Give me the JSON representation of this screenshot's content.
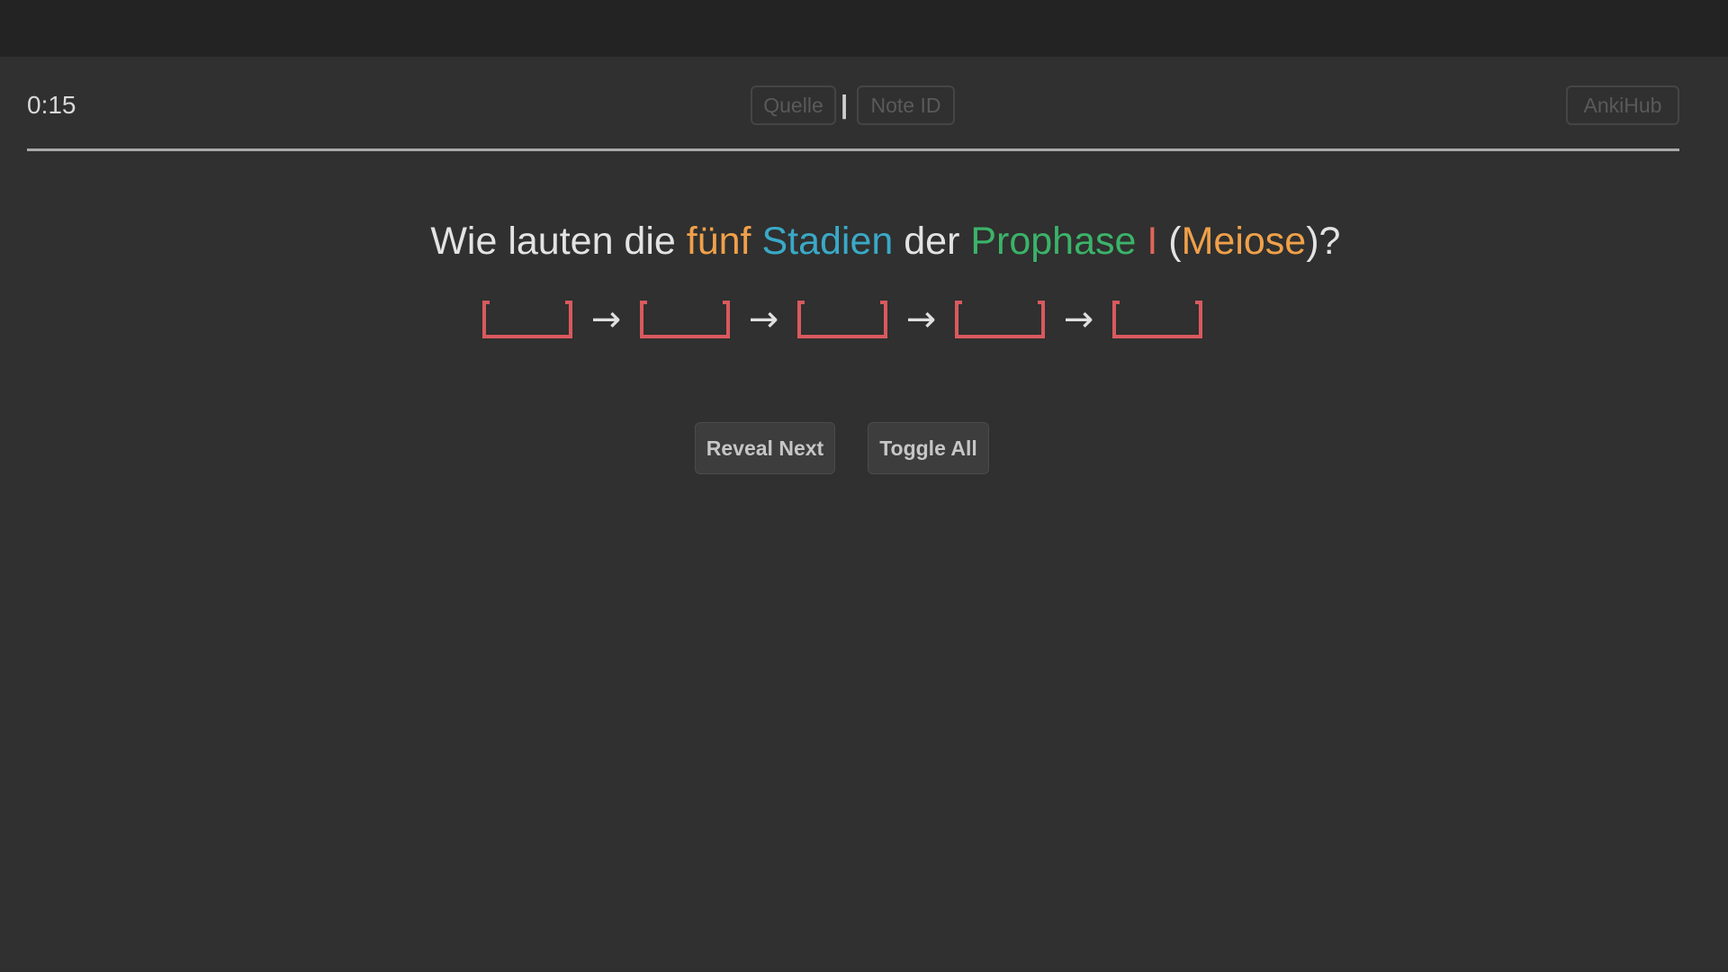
{
  "header": {
    "timer": "0:15",
    "source_label": "Quelle",
    "separator": "|",
    "note_id_label": "Note ID",
    "ankihub_label": "AnkiHub"
  },
  "question": {
    "segments": [
      {
        "text": "Wie lauten die ",
        "color": "#e3e3e3"
      },
      {
        "text": "fünf",
        "color": "#f0a04a"
      },
      {
        "text": " ",
        "color": "#e3e3e3"
      },
      {
        "text": "Stadien",
        "color": "#3aa9c7"
      },
      {
        "text": " der ",
        "color": "#e3e3e3"
      },
      {
        "text": "Prophase",
        "color": "#3bb36a"
      },
      {
        "text": " ",
        "color": "#e3e3e3"
      },
      {
        "text": "I",
        "color": "#e0665a"
      },
      {
        "text": " (",
        "color": "#e3e3e3"
      },
      {
        "text": "Meiose",
        "color": "#f0a04a"
      },
      {
        "text": ")?",
        "color": "#e3e3e3"
      }
    ]
  },
  "cloze": {
    "count": 5,
    "arrow": "→",
    "color": "#d9595e"
  },
  "actions": {
    "reveal_next_label": "Reveal Next",
    "toggle_all_label": "Toggle All"
  }
}
